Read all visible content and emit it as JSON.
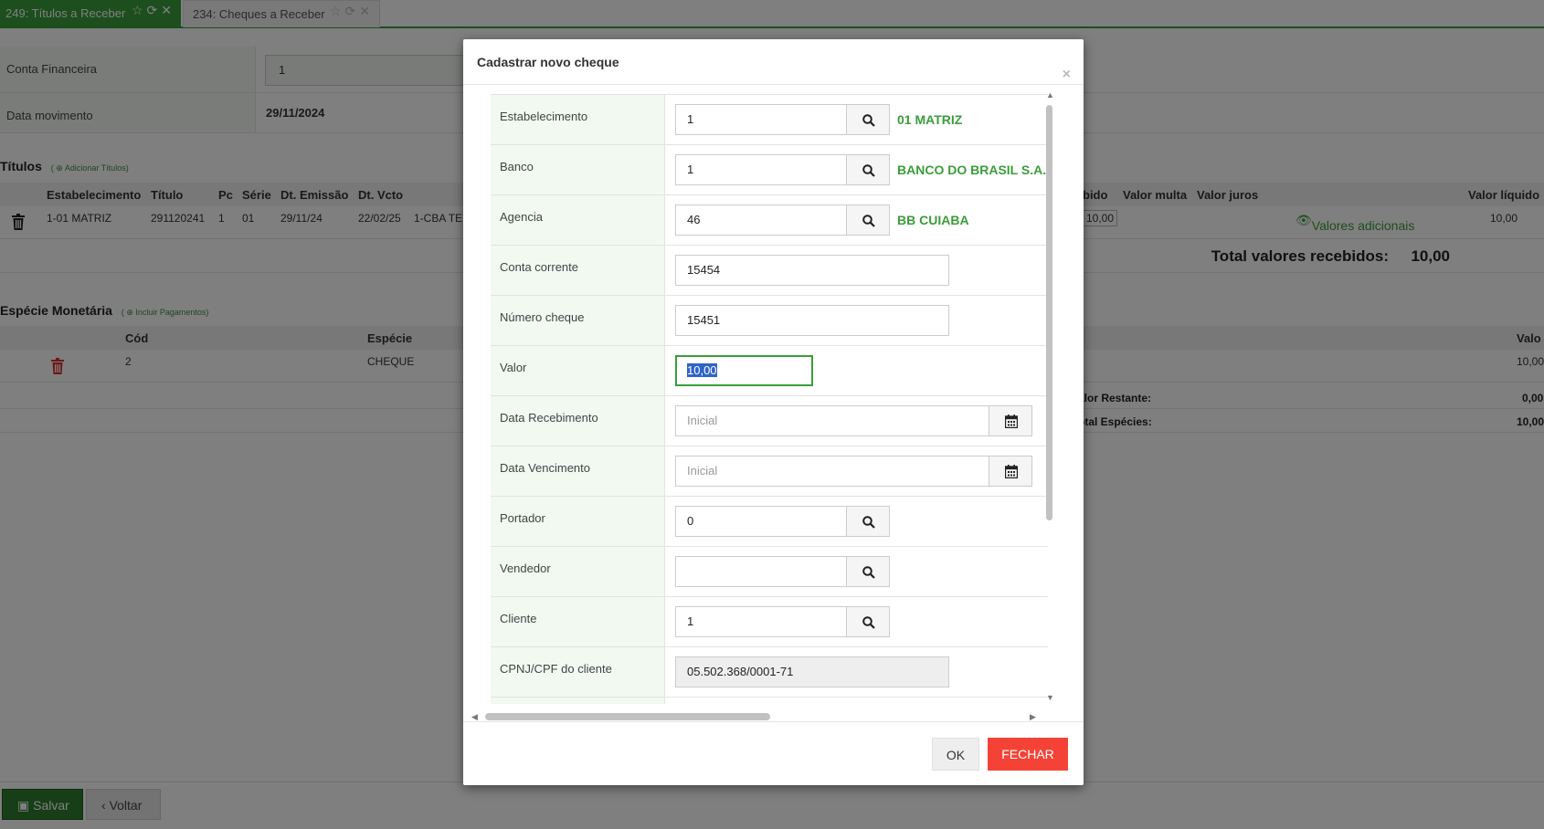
{
  "tabs": [
    {
      "label": "249: Títulos a Receber",
      "active": true
    },
    {
      "label": "234: Cheques a Receber",
      "active": false
    }
  ],
  "header_form": {
    "conta_label": "Conta Financeira",
    "conta_value": "1",
    "data_label": "Data movimento",
    "data_value": "29/11/2024"
  },
  "titulos": {
    "title": "Títulos",
    "add_link": "Adicionar Títulos",
    "columns": [
      "Estabelecimento",
      "Título",
      "Pc",
      "Série",
      "Dt. Emissão",
      "Dt. Vcto",
      "bido",
      "Valor multa",
      "Valor juros",
      "Valor líquido"
    ],
    "row": {
      "estabelecimento": "1-01 MATRIZ",
      "titulo": "291120241",
      "pc": "1",
      "serie": "01",
      "emissao": "29/11/24",
      "vcto": "22/02/25",
      "cliente": "1-CBA TE",
      "recebido": "10,00",
      "valores_link": "Valores adicionais",
      "liquido": "10,00"
    },
    "total_label": "Total valores recebidos:",
    "total_value": "10,00"
  },
  "especie": {
    "title": "Espécie Monetária",
    "add_link": "Incluir Pagamentos",
    "columns": [
      "Cód",
      "Espécie",
      "Valo"
    ],
    "row": {
      "cod": "2",
      "especie": "CHEQUE",
      "valor": "10,00"
    },
    "restante_label": "alor Restante:",
    "restante_value": "0,00",
    "total_label": "otal Espécies:",
    "total_value": "10,00"
  },
  "footer": {
    "salvar": "Salvar",
    "voltar": "Voltar"
  },
  "modal": {
    "title": "Cadastrar novo cheque",
    "fields": {
      "estabelecimento": {
        "label": "Estabelecimento",
        "value": "1",
        "desc": "01 MATRIZ"
      },
      "banco": {
        "label": "Banco",
        "value": "1",
        "desc": "BANCO DO BRASIL S.A."
      },
      "agencia": {
        "label": "Agencia",
        "value": "46",
        "desc": "BB CUIABA"
      },
      "conta_corrente": {
        "label": "Conta corrente",
        "value": "15454"
      },
      "numero_cheque": {
        "label": "Número cheque",
        "value": "15451"
      },
      "valor": {
        "label": "Valor",
        "value": "10,00"
      },
      "data_recebimento": {
        "label": "Data Recebimento",
        "placeholder": "Inicial"
      },
      "data_vencimento": {
        "label": "Data Vencimento",
        "placeholder": "Inicial"
      },
      "portador": {
        "label": "Portador",
        "value": "0"
      },
      "vendedor": {
        "label": "Vendedor",
        "value": ""
      },
      "cliente": {
        "label": "Cliente",
        "value": "1"
      },
      "cpf_cnpj": {
        "label": "CPNJ/CPF do cliente",
        "value": "05.502.368/0001-71"
      }
    },
    "ok_label": "OK",
    "fechar_label": "FECHAR"
  },
  "colors": {
    "accent_green": "#3a9d3a",
    "danger_red": "#f44336",
    "selection_blue": "#2f64c8"
  }
}
